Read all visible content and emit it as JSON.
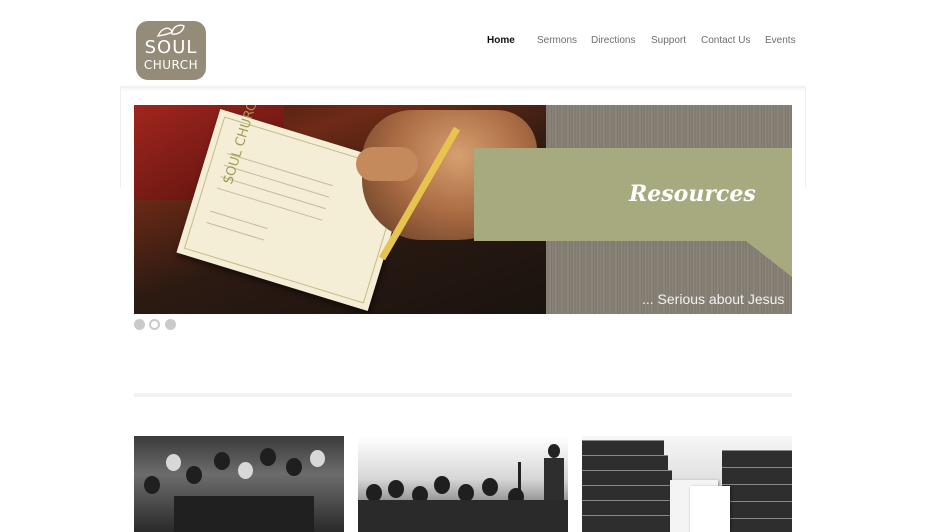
{
  "logo": {
    "line1": "SOUL",
    "line2": "CHURCH"
  },
  "nav": {
    "items": [
      {
        "label": "Home",
        "active": true
      },
      {
        "label": "Sermons",
        "active": false
      },
      {
        "label": "Directions",
        "active": false
      },
      {
        "label": "Support",
        "active": false
      },
      {
        "label": "Contact Us",
        "active": false
      },
      {
        "label": "Events",
        "active": false
      }
    ]
  },
  "slider": {
    "title": "Resources",
    "tagline": "... Serious about Jesus",
    "card_logo": "SOUL CHURCH",
    "slide_count": 3,
    "active_slide": 2
  },
  "colors": {
    "logo_bg": "#958b79",
    "banner": "#a6aa7e",
    "nav_active": "#111111",
    "nav_text": "#6e6e6e"
  }
}
